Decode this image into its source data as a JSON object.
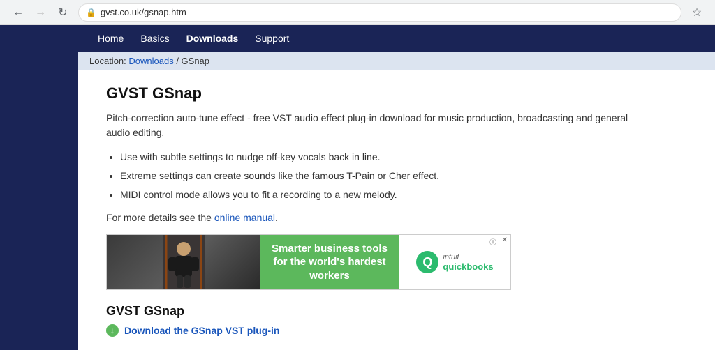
{
  "browser": {
    "url": "gvst.co.uk/gsnap.htm",
    "back_disabled": false,
    "forward_disabled": true
  },
  "nav": {
    "items": [
      {
        "label": "Home",
        "active": false
      },
      {
        "label": "Basics",
        "active": false
      },
      {
        "label": "Downloads",
        "active": true
      },
      {
        "label": "Support",
        "active": false
      }
    ]
  },
  "breadcrumb": {
    "prefix": "Location: ",
    "link_text": "Downloads",
    "separator": " / ",
    "current": "GSnap"
  },
  "page": {
    "title": "GVST GSnap",
    "description": "Pitch-correction auto-tune effect - free VST audio effect plug-in download for music production, broadcasting and general audio editing.",
    "features": [
      "Use with subtle settings to nudge off-key vocals back in line.",
      "Extreme settings can create sounds like the famous T-Pain or Cher effect.",
      "MIDI control mode allows you to fit a recording to a new melody."
    ],
    "manual_prefix": "For more details see the ",
    "manual_link": "online manual",
    "manual_suffix": "."
  },
  "ad": {
    "green_text_line1": "Smarter business tools",
    "green_text_line2": "for the world's hardest workers",
    "brand": "quickbooks",
    "brand_prefix": "intuit"
  },
  "download": {
    "title": "GVST GSnap",
    "link_text": "Download the GSnap VST plug-in",
    "icon": "↓"
  }
}
